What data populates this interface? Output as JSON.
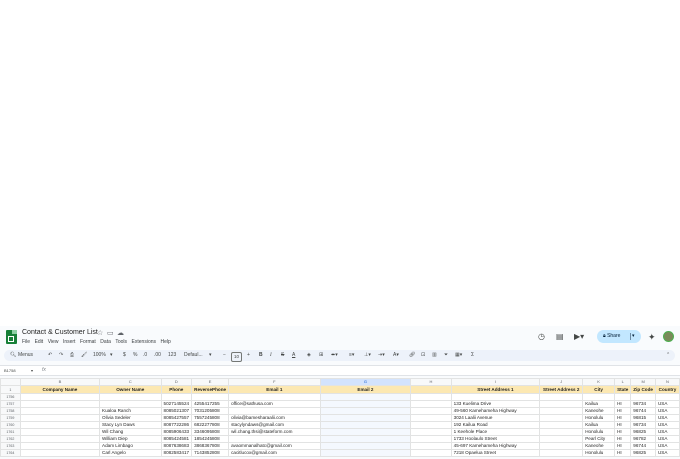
{
  "window": {
    "title": "Contact & Customer List"
  },
  "menu": [
    "File",
    "Edit",
    "View",
    "Insert",
    "Format",
    "Data",
    "Tools",
    "Extensions",
    "Help"
  ],
  "toolbar": {
    "menus_label": "Menus",
    "zoom": "100%",
    "currency": "$",
    "percent": "%",
    "decimal_dec": ".0",
    "decimal_inc": ".00",
    "number_format": "123",
    "font": "Defaul...",
    "font_size": "10",
    "bold": "B",
    "italic": "I",
    "strike": "S",
    "text_color": "A"
  },
  "share": {
    "label": "Share"
  },
  "formula_bar": {
    "cell_ref": "B1758",
    "fx": "fx",
    "value": ""
  },
  "grid": {
    "column_letters": [
      "",
      "B",
      "C",
      "D",
      "E",
      "F",
      "G",
      "H",
      "I",
      "J",
      "K",
      "L",
      "M",
      "N"
    ],
    "header_row_number": "1",
    "headers": [
      "Company Name",
      "Owner Name",
      "Phone",
      "ReversePhone",
      "Email 1",
      "Email 2",
      "",
      "Street Address 1",
      "Street Address 2",
      "City",
      "State",
      "Zip Code",
      "Country"
    ],
    "rows": [
      {
        "n": "1756",
        "cells": [
          "",
          "",
          "",
          "",
          "",
          "",
          "",
          "",
          "",
          "",
          "",
          "",
          ""
        ]
      },
      {
        "n": "1757",
        "cells": [
          "",
          "",
          "5027145524",
          "4255417255",
          "office@sathusa.com",
          "",
          "",
          "133 Kuelima Drive",
          "",
          "Kailua",
          "HI",
          "96734",
          "USA"
        ]
      },
      {
        "n": "1758",
        "cells": [
          "",
          "Kualoa Ranch",
          "8085021307",
          "7031205808",
          "",
          "",
          "",
          "49-560 Kamehameha Highway",
          "",
          "Kaneohe",
          "HI",
          "96744",
          "USA"
        ]
      },
      {
        "n": "1759",
        "cells": [
          "",
          "Olivia Sedeler",
          "8085427557",
          "7557245808",
          "olivia@bamesharaalii.com",
          "",
          "",
          "3024 Laalii Avenue",
          "",
          "Honolulu",
          "HI",
          "96815",
          "USA"
        ]
      },
      {
        "n": "1760",
        "cells": [
          "",
          "Stacy Lyn Daws",
          "8087722286",
          "6822277808",
          "stacylyndaws@gmail.com",
          "",
          "",
          "192 Kailua Road",
          "",
          "Kailua",
          "HI",
          "96734",
          "USA"
        ]
      },
      {
        "n": "1761",
        "cells": [
          "",
          "Wil Chang",
          "8085906433",
          "3346095808",
          "wil.chang.thsi@stateform.com",
          "",
          "",
          "1 Keehole Place",
          "",
          "Honolulu",
          "HI",
          "96825",
          "USA"
        ]
      },
      {
        "n": "1762",
        "cells": [
          "",
          "William Diep",
          "8085424581",
          "1854245808",
          "",
          "",
          "",
          "1733 Hoolaulo Street",
          "",
          "Pearl City",
          "HI",
          "96782",
          "USA"
        ]
      },
      {
        "n": "1763",
        "cells": [
          "",
          "Adam Limbago",
          "8087638683",
          "3868367808",
          "avaommanalhatc@gmail.com",
          "",
          "",
          "45-697 Kamehameha Highway",
          "",
          "Kaneohe",
          "HI",
          "96744",
          "USA"
        ]
      },
      {
        "n": "1764",
        "cells": [
          "",
          "Carl Angelo",
          "8082583417",
          "7143852808",
          "cacitlucox@gmail.com",
          "",
          "",
          "7218 Opaelua Street",
          "",
          "Honolulu",
          "HI",
          "96825",
          "USA"
        ]
      }
    ]
  }
}
